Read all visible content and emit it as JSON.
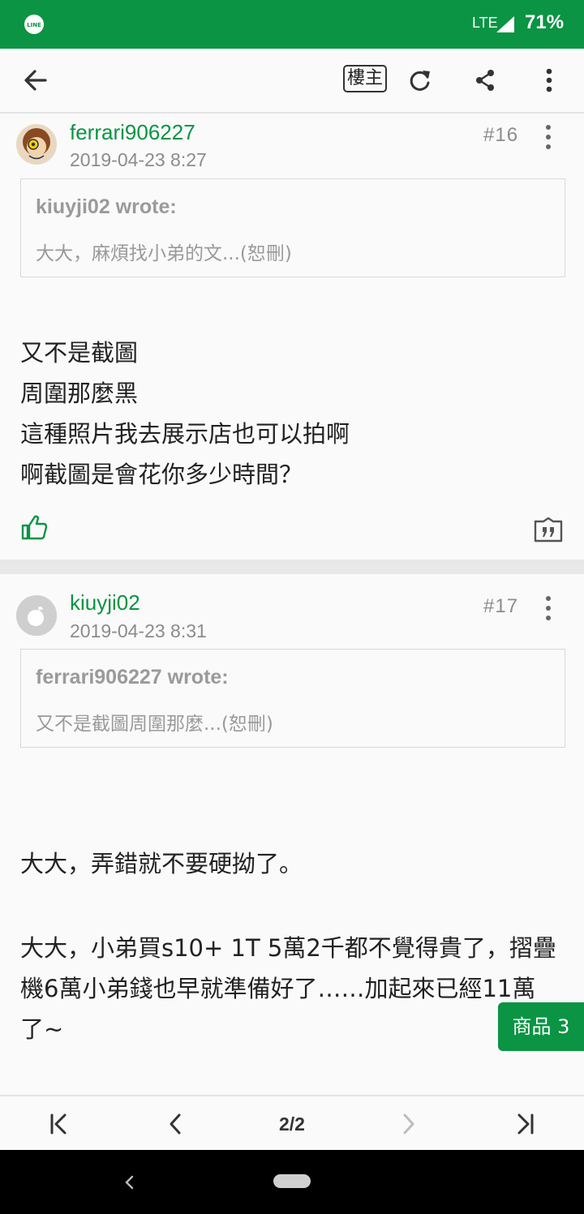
{
  "status_bar": {
    "network": "LTE",
    "battery": "71%"
  },
  "app_bar": {
    "op_label": "樓主"
  },
  "posts": [
    {
      "username": "ferrari906227",
      "date": "2019-04-23 8:27",
      "floor": "#16",
      "quote": {
        "author": "kiuyji02 wrote:",
        "text": "大大，麻煩找小弟的文...(恕刪)"
      },
      "lines": [
        "又不是截圖",
        "周圍那麼黑",
        "這種照片我去展示店也可以拍啊",
        "啊截圖是會花你多少時間？"
      ]
    },
    {
      "username": "kiuyji02",
      "date": "2019-04-23 8:31",
      "floor": "#17",
      "quote": {
        "author": "ferrari906227 wrote:",
        "text": "又不是截圖周圍那麼...(恕刪)"
      },
      "lines": [
        "大大，弄錯就不要硬拗了。",
        "大大，小弟買s10+ 1T 5萬2千都不覺得貴了，摺疊",
        "機6萬小弟錢也早就準備好了……加起來已經11萬",
        "了~"
      ]
    }
  ],
  "products_button": "商品 3",
  "pager": {
    "current": "2/2"
  },
  "colors": {
    "brand_green": "#0a9443"
  }
}
